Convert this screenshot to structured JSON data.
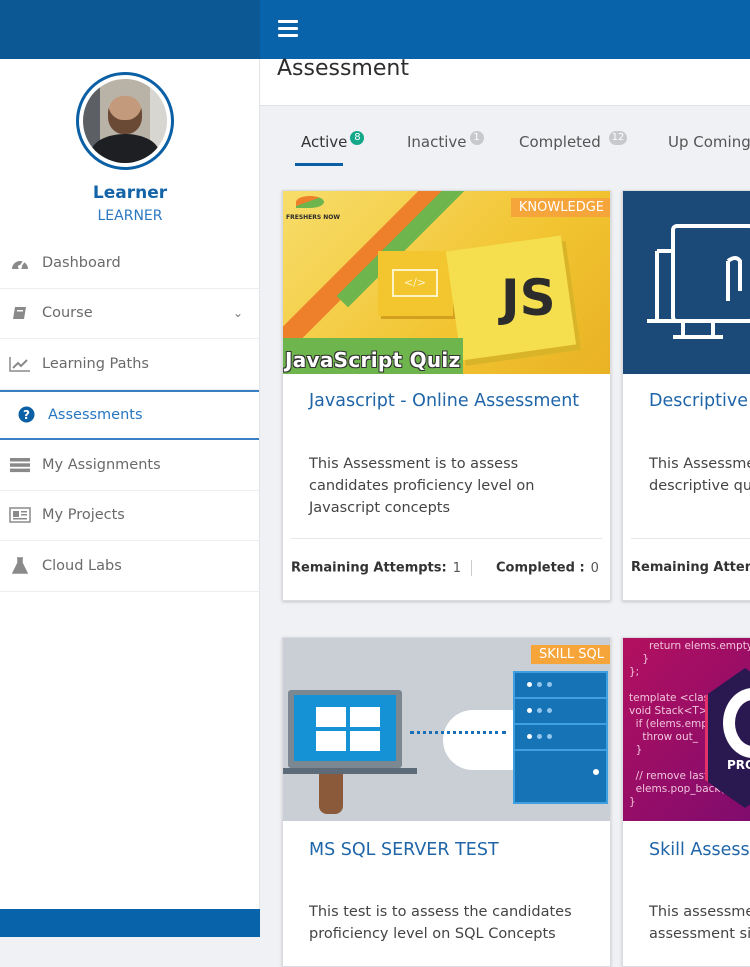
{
  "header": {
    "menu_icon": "hamburger-icon"
  },
  "user": {
    "name": "Learner",
    "role": "LEARNER"
  },
  "sidebar": {
    "items": [
      {
        "label": "Dashboard",
        "icon": "dashboard-gauge-icon",
        "active": false
      },
      {
        "label": "Course",
        "icon": "book-icon",
        "active": false,
        "expandable": true
      },
      {
        "label": "Learning Paths",
        "icon": "line-chart-icon",
        "active": false
      },
      {
        "label": "Assessments",
        "icon": "question-circle-icon",
        "active": true
      },
      {
        "label": "My Assignments",
        "icon": "list-stack-icon",
        "active": false
      },
      {
        "label": "My Projects",
        "icon": "newspaper-icon",
        "active": false
      },
      {
        "label": "Cloud Labs",
        "icon": "flask-icon",
        "active": false
      }
    ]
  },
  "page": {
    "title": "Assessment"
  },
  "tabs": [
    {
      "label": "Active",
      "count": "8",
      "active": true
    },
    {
      "label": "Inactive",
      "count": "1",
      "active": false
    },
    {
      "label": "Completed",
      "count": "12",
      "active": false
    },
    {
      "label": "Up Coming",
      "count": "",
      "active": false
    }
  ],
  "cards": [
    {
      "tag": "KNOWLEDGE",
      "image_caption": "JavaScript Quiz",
      "image_brand": "FRESHERS NOW",
      "image_js": "JS",
      "image_code": "</>",
      "title": "Javascript - Online Assessment",
      "description": "This Assessment is to assess candidates proficiency level on Javascript concepts",
      "remaining_label": "Remaining Attempts:",
      "remaining_value": "1",
      "completed_label": "Completed :",
      "completed_value": "0"
    },
    {
      "tag": "",
      "title": "Descriptive",
      "description": "This Assessme descriptive qu",
      "remaining_label": "Remaining Attemp"
    },
    {
      "tag": "SKILL SQL",
      "title": "MS SQL SERVER TEST",
      "description": "This test is to assess the candidates proficiency level on SQL Concepts"
    },
    {
      "tag": "",
      "image_code_text": "      return elems.empty\n    }\n};\n\ntemplate <clas\nvoid Stack<T>:\n  if (elems.emp\n    throw out_\n  }\n\n  // remove last e\n  elems.pop_back();\n}",
      "image_badge": "PRO",
      "title": "Skill Assessm",
      "description": "This assessme assessment si"
    }
  ]
}
